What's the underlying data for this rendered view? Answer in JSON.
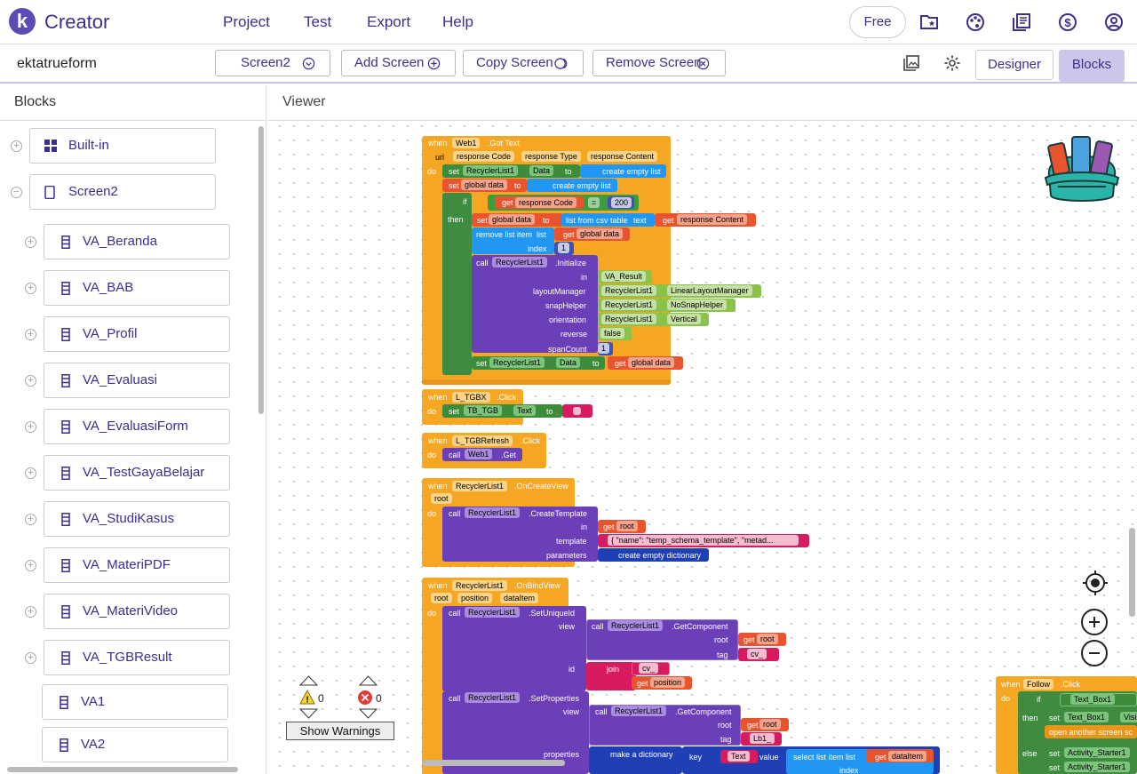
{
  "app": {
    "logo": "k",
    "name": "Creator"
  },
  "menu": [
    "Project",
    "Test",
    "Export",
    "Help"
  ],
  "free_label": "Free",
  "top_icons": [
    "folder-star-icon",
    "palette-icon",
    "library-icon",
    "dollar-icon",
    "account-icon"
  ],
  "project_name": "ektatrueform",
  "screen_select": "Screen2",
  "toolbar": {
    "add": "Add Screen",
    "copy": "Copy Screen",
    "remove": "Remove Screen",
    "designer": "Designer",
    "blocks": "Blocks"
  },
  "left_panel": {
    "title": "Blocks",
    "items": [
      "Built-in",
      "Screen2",
      "VA_Beranda",
      "VA_BAB",
      "VA_Profil",
      "VA_Evaluasi",
      "VA_EvaluasiForm",
      "VA_TestGayaBelajar",
      "VA_StudiKasus",
      "VA_MateriPDF",
      "VA_MateriVideo",
      "VA_TGBResult",
      "VA1",
      "VA2"
    ]
  },
  "viewer_title": "Viewer",
  "warnings": {
    "warn_count": "0",
    "error_count": "0",
    "button": "Show Warnings"
  },
  "blocks": {
    "b1": {
      "when": "when",
      "comp": "Web1",
      "event": ".Got Text",
      "p1": "url",
      "p2": "response Code",
      "p3": "response Type",
      "p4": "response Content",
      "do": "do",
      "set": "set",
      "setcomp": "RecyclerList1",
      "setprop": "Data",
      "to": "to",
      "create_list": "create empty list",
      "set2": "global data",
      "if": "if",
      "get": "get",
      "rc": "response Code",
      "eq": "=",
      "num200": "200",
      "then": "then",
      "csv": "list from csv table",
      "text": "text",
      "rcont": "response Content",
      "remove": "remove list item",
      "list": "list",
      "index": "index",
      "one": "1",
      "call": "call",
      "init": ".Initialize",
      "in": "in",
      "varesult": "VA_Result",
      "lm": "layoutManager",
      "llm": "LinearLayoutManager",
      "sh": "snapHelper",
      "nsh": "NoSnapHelper",
      "or": "orientation",
      "vert": "Vertical",
      "rev": "reverse",
      "false": "false",
      "sc": "spanCount"
    },
    "b2": {
      "comp": "L_TGBX",
      "event": ".Click",
      "setcomp": "TB_TGB",
      "prop": "Text"
    },
    "b3": {
      "comp": "L_TGBRefresh",
      "event": ".Click",
      "web": "Web1",
      "get": ".Get"
    },
    "b4": {
      "comp": "RecyclerList1",
      "event": ".OnCreateView",
      "root": "root",
      "ct": ".CreateTemplate",
      "template": "template",
      "tpl": "{ \"name\": \"temp_schema_template\", \"metad...",
      "params": "parameters",
      "dict": "create empty dictionary"
    },
    "b5": {
      "comp": "RecyclerList1",
      "event": ".OnBindView",
      "position": "position",
      "dataitem": "dataItem",
      "suid": ".SetUniqueId",
      "view": "view",
      "gc": ".GetComponent",
      "root": "root",
      "tag": "tag",
      "cv": "cv_",
      "id": "id",
      "join": "join",
      "sp": ".SetProperties",
      "lb": "Lb1_",
      "props": "properties",
      "mkdict": "make a dictionary",
      "key": "key",
      "textv": "Text",
      "value": "value",
      "sel": "select list item  list",
      "index": "index"
    },
    "b6": {
      "comp": "Follow",
      "event": ".Click",
      "tb": "Text_Box1",
      "then": "then",
      "vis": "Visi",
      "open": "open another screen  sc",
      "else": "else",
      "act": "Activity_Starter1"
    }
  }
}
